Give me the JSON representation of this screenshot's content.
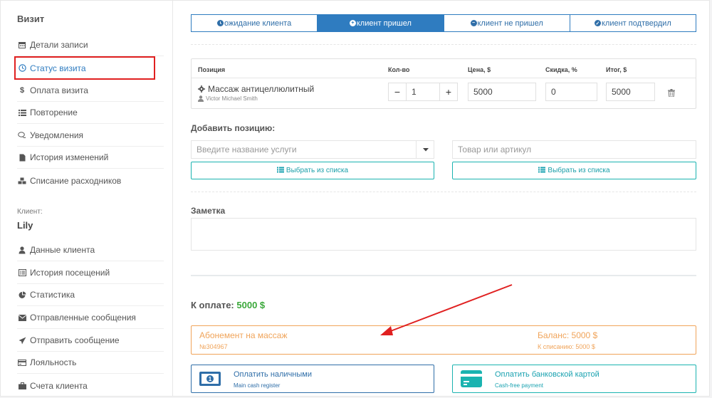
{
  "sidebar": {
    "section_title": "Визит",
    "visit_items": [
      {
        "label": "Детали записи",
        "icon": "calendar-icon"
      },
      {
        "label": "Статус визита",
        "icon": "clock-icon"
      },
      {
        "label": "Оплата визита",
        "icon": "dollar-icon"
      },
      {
        "label": "Повторение",
        "icon": "list-icon"
      },
      {
        "label": "Уведомления",
        "icon": "chat-icon"
      },
      {
        "label": "История изменений",
        "icon": "file-icon"
      },
      {
        "label": "Списание расходников",
        "icon": "cubes-icon"
      }
    ],
    "client_label": "Клиент:",
    "client_name": "Lily",
    "client_items": [
      {
        "label": "Данные клиента",
        "icon": "user-icon"
      },
      {
        "label": "История посещений",
        "icon": "list-alt-icon"
      },
      {
        "label": "Статистика",
        "icon": "pie-chart-icon"
      },
      {
        "label": "Отправленные сообщения",
        "icon": "envelope-icon"
      },
      {
        "label": "Отправить сообщение",
        "icon": "paper-plane-icon"
      },
      {
        "label": "Лояльность",
        "icon": "card-icon"
      },
      {
        "label": "Счета клиента",
        "icon": "briefcase-icon"
      }
    ]
  },
  "status_tabs": [
    {
      "label": "ожидание клиента",
      "icon": "clock-icon",
      "active": false
    },
    {
      "label": "клиент пришел",
      "icon": "plus-circle-icon",
      "active": true
    },
    {
      "label": "клиент не пришел",
      "icon": "minus-circle-icon",
      "active": false
    },
    {
      "label": "клиент подтвердил",
      "icon": "check-circle-icon",
      "active": false
    }
  ],
  "table": {
    "headers": {
      "position": "Позиция",
      "qty": "Кол-во",
      "price": "Цена, $",
      "discount": "Скидка, %",
      "total": "Итог, $"
    },
    "row": {
      "name": "Массаж антицеллюлитный",
      "staff": "Victor Michael Smith",
      "qty_minus": "−",
      "qty": "1",
      "qty_plus": "+",
      "price": "5000",
      "discount": "0",
      "total": "5000"
    }
  },
  "add_position": {
    "label": "Добавить позицию:",
    "service_placeholder": "Введите название услуги",
    "product_placeholder": "Товар или артикул",
    "choose_list_label": "Выбрать из списка"
  },
  "note": {
    "label": "Заметка"
  },
  "payment": {
    "label": "К оплате:",
    "amount": "5000 $",
    "subscription": {
      "name": "Абонемент на массаж",
      "number": "№304967",
      "balance": "Баланс: 5000 $",
      "to_debit": "К списанию: 5000 $"
    },
    "cash_button": {
      "title": "Оплатить наличными",
      "subtitle": "Main cash register"
    },
    "card_button": {
      "title": "Оплатить банковской картой",
      "subtitle": "Cash-free payment"
    }
  },
  "colors": {
    "accent_blue": "#2f7cc0",
    "teal": "#1ab3b0",
    "orange": "#f0a45a",
    "green": "#3aa83a",
    "annotation_red": "#e02020"
  }
}
